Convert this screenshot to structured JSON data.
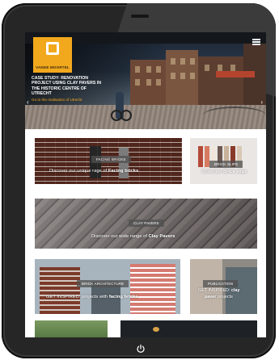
{
  "brand": {
    "logo_text": "VANDE MOORTEL",
    "accent_color": "#f2a81d"
  },
  "hero": {
    "case_title": "CASE STUDY: RENOVATION PROJECT USING CLAY PAVERS IN THE HISTORIC CENTRE OF UTRECHT",
    "case_link": "Go to the realisation of Utrecht"
  },
  "tiles": {
    "facing_bricks": {
      "badge": "FACING BRICKS",
      "caption_prefix": "Discover our unique rage of ",
      "caption_bold": "Facing bricks"
    },
    "brick_slips": {
      "badge": "BRICK SLIPS",
      "caption_prefix": "Collection ",
      "caption_bold": "Brick slips"
    },
    "clay_pavers": {
      "badge": "CLAY PAVERS",
      "caption_prefix": "Discover our wide range of ",
      "caption_bold": "Clay Pavers"
    },
    "brick_architecture": {
      "badge": "BRICK ARCHITECTURE",
      "caption_prefix": "GET INSPIRED: projects with ",
      "caption_bold": "facing bricks"
    },
    "publication": {
      "badge": "PUBLICATION",
      "caption_line1": "GET INSPIRED: ",
      "caption_line1_bold": "clay",
      "caption_line2_bold": "paver",
      "caption_line2": " projects"
    }
  },
  "icons": {
    "menu": "hamburger-icon",
    "home": "power-icon"
  }
}
